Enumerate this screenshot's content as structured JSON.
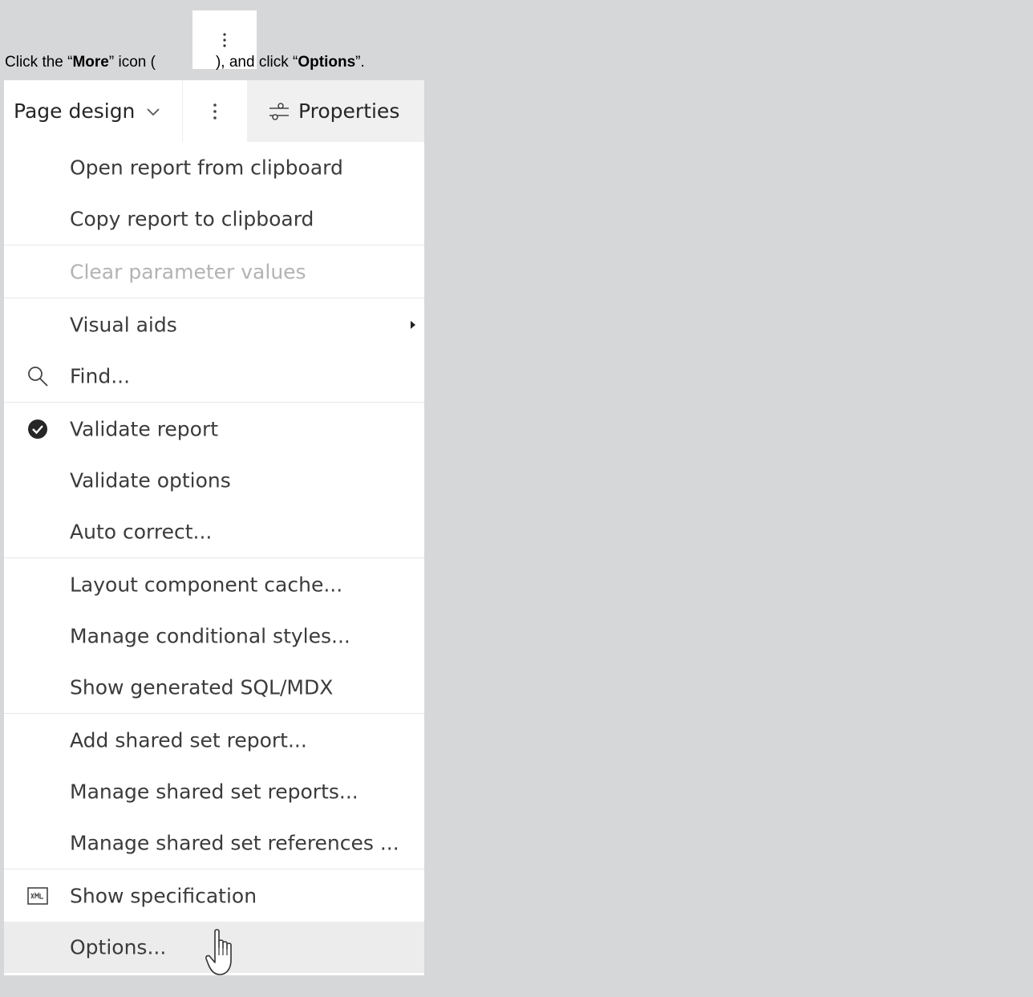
{
  "instruction": {
    "prefix": "Click the “",
    "more": "More",
    "mid": "” icon (",
    "after": "), and click “",
    "options": "Options",
    "suffix": "”."
  },
  "toolbar": {
    "page_design": "Page design",
    "properties": "Properties"
  },
  "menu": {
    "items": [
      {
        "label": "Open report from clipboard"
      },
      {
        "label": "Copy report to clipboard"
      },
      {
        "label": "Clear parameter values"
      },
      {
        "label": "Visual aids"
      },
      {
        "label": "Find..."
      },
      {
        "label": "Validate report"
      },
      {
        "label": "Validate options"
      },
      {
        "label": "Auto correct..."
      },
      {
        "label": "Layout component cache..."
      },
      {
        "label": "Manage conditional styles..."
      },
      {
        "label": "Show generated SQL/MDX"
      },
      {
        "label": "Add shared set report..."
      },
      {
        "label": "Manage shared set reports..."
      },
      {
        "label": "Manage shared set references ..."
      },
      {
        "label": "Show specification"
      },
      {
        "label": "Options..."
      }
    ]
  },
  "icons": {
    "more": "kebab-vertical-icon",
    "chevron": "chevron-down-icon",
    "properties": "sliders-icon",
    "submenu": "caret-right-icon",
    "find": "search-icon",
    "validate": "checkmark-filled-icon",
    "specification": "xml-icon",
    "pointer": "hand-pointer-icon"
  },
  "colors": {
    "background": "#d6d7d9",
    "panel": "#ffffff",
    "text": "#3b3b3b",
    "disabled": "#b3b3b3",
    "hover": "#ececec"
  }
}
